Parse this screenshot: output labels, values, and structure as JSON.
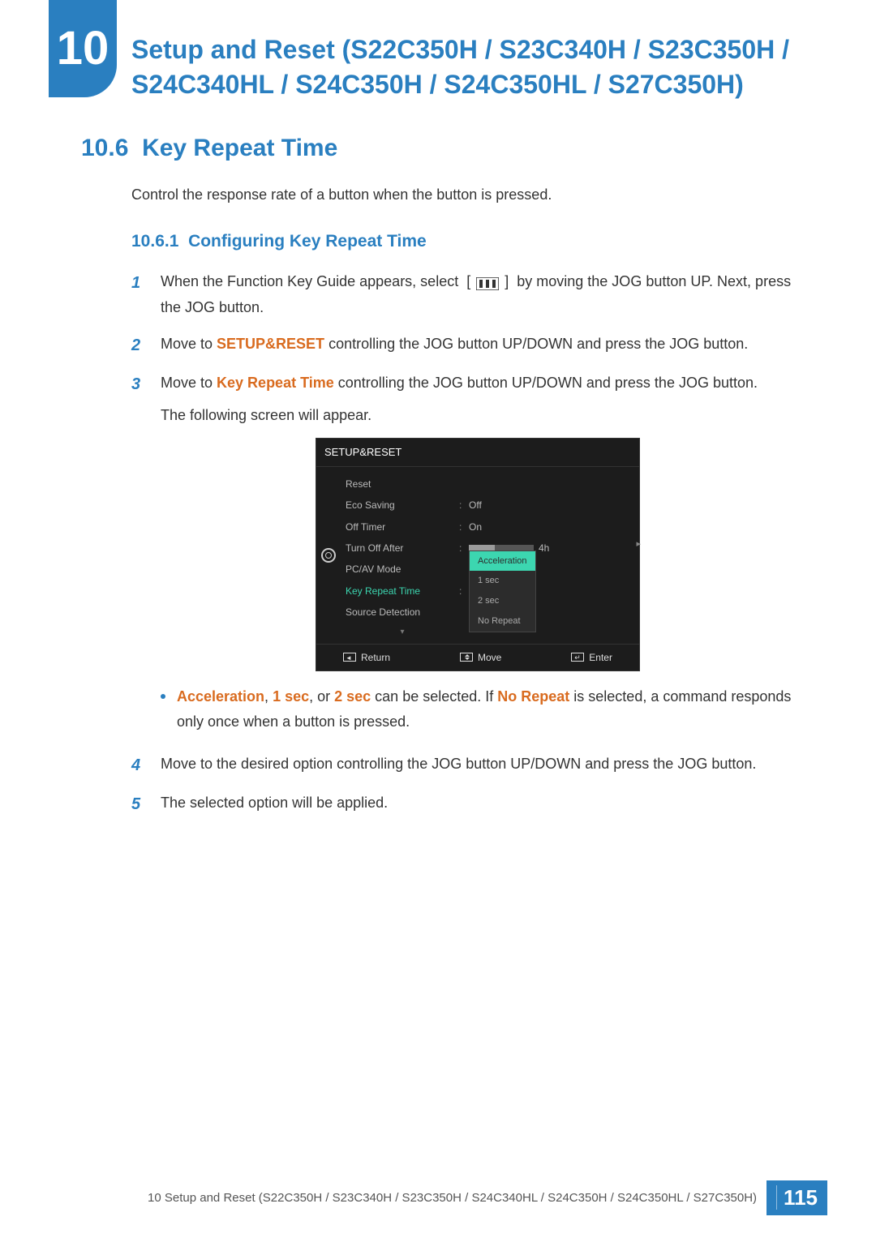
{
  "chapter": {
    "number": "10",
    "title": "Setup and Reset (S22C350H / S23C340H / S23C350H / S24C340HL / S24C350H / S24C350HL / S27C350H)"
  },
  "section": {
    "number": "10.6",
    "title": "Key Repeat Time",
    "intro": "Control the response rate of a button when the button is pressed."
  },
  "subsection": {
    "number": "10.6.1",
    "title": "Configuring Key Repeat Time"
  },
  "steps": {
    "s1a": "When the Function Key Guide appears, select",
    "s1b": "by moving the JOG button UP. Next, press the JOG button.",
    "s2a": "Move to ",
    "s2_bold": "SETUP&RESET",
    "s2b": " controlling the JOG button UP/DOWN and press the JOG button.",
    "s3a": "Move to ",
    "s3_bold": "Key Repeat Time",
    "s3b": " controlling the JOG button UP/DOWN and press the JOG button.",
    "s3c": "The following screen will appear.",
    "bullet_a1": "Acceleration",
    "bullet_a2": ", ",
    "bullet_a3": "1 sec",
    "bullet_a4": ", or ",
    "bullet_a5": "2 sec",
    "bullet_a6": " can be selected. If ",
    "bullet_a7": "No Repeat",
    "bullet_a8": " is selected, a command responds only once when a button is pressed.",
    "s4": "Move to the desired option controlling the JOG button UP/DOWN and press the JOG button.",
    "s5": "The selected option will be applied."
  },
  "nums": {
    "n1": "1",
    "n2": "2",
    "n3": "3",
    "n4": "4",
    "n5": "5"
  },
  "osd": {
    "title": "SETUP&RESET",
    "items": {
      "reset": "Reset",
      "eco": "Eco Saving",
      "eco_val": "Off",
      "offtimer": "Off Timer",
      "offtimer_val": "On",
      "turnoff": "Turn Off After",
      "turnoff_val": "4h",
      "pcav": "PC/AV Mode",
      "keyrepeat": "Key Repeat Time",
      "source": "Source Detection"
    },
    "options": {
      "o1": "Acceleration",
      "o2": "1 sec",
      "o3": "2 sec",
      "o4": "No Repeat"
    },
    "footer": {
      "return": "Return",
      "move": "Move",
      "enter": "Enter"
    }
  },
  "footer": {
    "text": "10 Setup and Reset (S22C350H / S23C340H / S23C350H / S24C340HL / S24C350H / S24C350HL / S27C350H)",
    "page": "115"
  }
}
